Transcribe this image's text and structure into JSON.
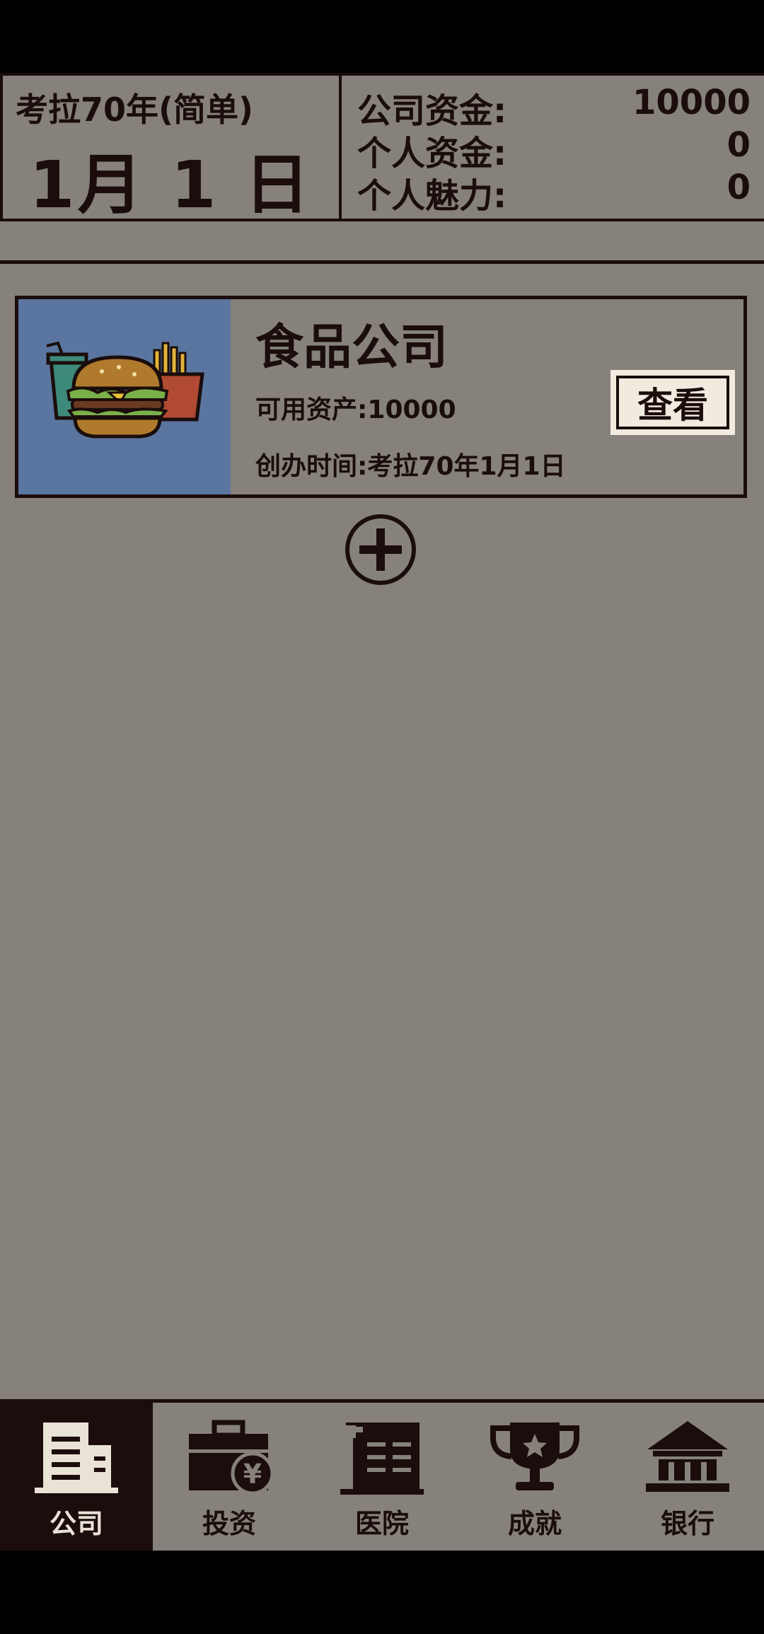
{
  "header": {
    "era": "考拉70年(简单)",
    "date": "1月 1 日",
    "stats": [
      {
        "label": "公司资金:",
        "value": "10000"
      },
      {
        "label": "个人资金:",
        "value": "0"
      },
      {
        "label": "个人魅力:",
        "value": "0"
      }
    ]
  },
  "company": {
    "name": "食品公司",
    "assets": "可用资产:10000",
    "founded": "创办时间:考拉70年1月1日",
    "view_label": "查看",
    "icon": "burger-fries-icon"
  },
  "add_icon": "plus-circle-icon",
  "nav": {
    "tabs": [
      {
        "label": "公司",
        "icon": "building-icon",
        "active": true
      },
      {
        "label": "投资",
        "icon": "briefcase-yen-icon",
        "active": false
      },
      {
        "label": "医院",
        "icon": "hospital-icon",
        "active": false
      },
      {
        "label": "成就",
        "icon": "trophy-icon",
        "active": false
      },
      {
        "label": "银行",
        "icon": "bank-icon",
        "active": false
      }
    ]
  },
  "colors": {
    "background": "#86817b",
    "ink": "#1a0d0b",
    "card_image_bg": "#5a76a0",
    "button_bg": "#f1ebdf"
  }
}
